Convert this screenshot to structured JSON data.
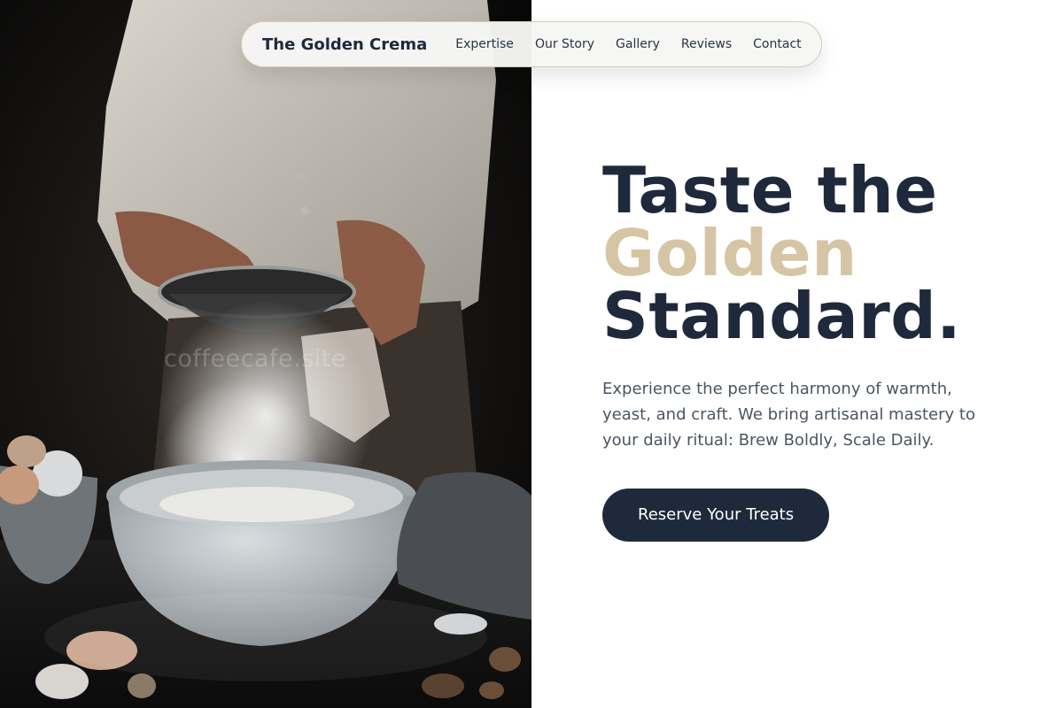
{
  "nav": {
    "brand": "The Golden Crema",
    "links": [
      "Expertise",
      "Our Story",
      "Gallery",
      "Reviews",
      "Contact"
    ]
  },
  "hero": {
    "headline_line1": "Taste the",
    "headline_line2": "Golden",
    "headline_line3": "Standard.",
    "description": "Experience the perfect harmony of warmth, yeast, and craft. We bring artisanal mastery to your daily ritual: Brew Boldly, Scale Daily.",
    "cta_label": "Reserve Your Treats",
    "image_watermark": "coffeecafe.site"
  },
  "colors": {
    "navy": "#1e293b",
    "gold_accent": "#d6c5a4",
    "body_text": "#4b5563",
    "background": "#ffffff"
  }
}
